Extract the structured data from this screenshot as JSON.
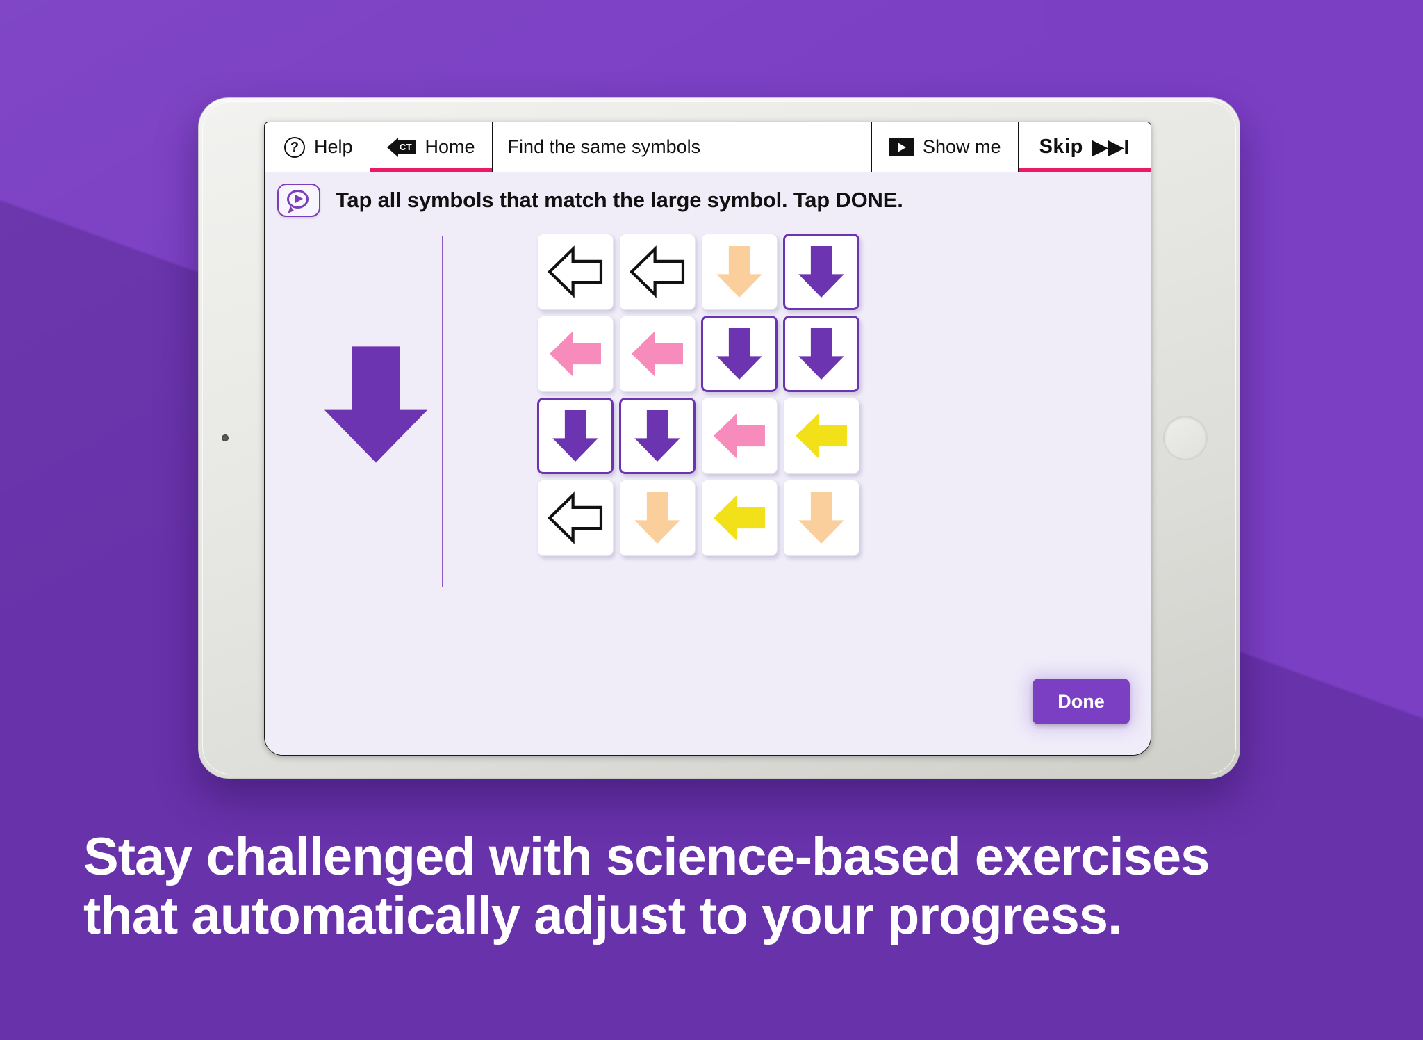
{
  "theme": {
    "background": "#7b3fc4",
    "accent_purple": "#6c34b0",
    "accent_pink": "#ec1a63",
    "screen_bg": "#f0edf9"
  },
  "toolbar": {
    "help_label": "Help",
    "help_icon": "question-circle-icon",
    "home_label": "Home",
    "home_icon": "ct-back-arrow-icon",
    "title": "Find the same symbols",
    "show_me_label": "Show me",
    "show_me_icon": "play-icon",
    "skip_label": "Skip",
    "skip_icon": "▶▶I"
  },
  "instruction": {
    "speak_icon": "speech-bubble-play-icon",
    "text": "Tap all symbols that match the large symbol. Tap DONE."
  },
  "task": {
    "target": {
      "direction": "down",
      "color": "#6c34b0",
      "style": "solid"
    },
    "grid": {
      "rows": 4,
      "cols": 4,
      "tiles": [
        {
          "direction": "left",
          "color": "#111111",
          "style": "outline",
          "selected": false
        },
        {
          "direction": "left",
          "color": "#111111",
          "style": "outline",
          "selected": false
        },
        {
          "direction": "down",
          "color": "#fbcf9c",
          "style": "solid",
          "selected": false
        },
        {
          "direction": "down",
          "color": "#6c34b0",
          "style": "solid",
          "selected": true
        },
        {
          "direction": "left",
          "color": "#f78bbc",
          "style": "solid",
          "selected": false
        },
        {
          "direction": "left",
          "color": "#f78bbc",
          "style": "solid",
          "selected": false
        },
        {
          "direction": "down",
          "color": "#6c34b0",
          "style": "solid",
          "selected": true
        },
        {
          "direction": "down",
          "color": "#6c34b0",
          "style": "solid",
          "selected": true
        },
        {
          "direction": "down",
          "color": "#6c34b0",
          "style": "solid",
          "selected": true
        },
        {
          "direction": "down",
          "color": "#6c34b0",
          "style": "solid",
          "selected": true
        },
        {
          "direction": "left",
          "color": "#f78bbc",
          "style": "solid",
          "selected": false
        },
        {
          "direction": "left",
          "color": "#f2e118",
          "style": "solid",
          "selected": false
        },
        {
          "direction": "left",
          "color": "#111111",
          "style": "outline",
          "selected": false
        },
        {
          "direction": "down",
          "color": "#fbcf9c",
          "style": "solid",
          "selected": false
        },
        {
          "direction": "left",
          "color": "#f2e118",
          "style": "solid",
          "selected": false
        },
        {
          "direction": "down",
          "color": "#fbcf9c",
          "style": "solid",
          "selected": false
        }
      ]
    },
    "done_label": "Done"
  },
  "caption": {
    "line1": "Stay challenged with science-based exercises",
    "line2": "that automatically adjust to your progress."
  }
}
